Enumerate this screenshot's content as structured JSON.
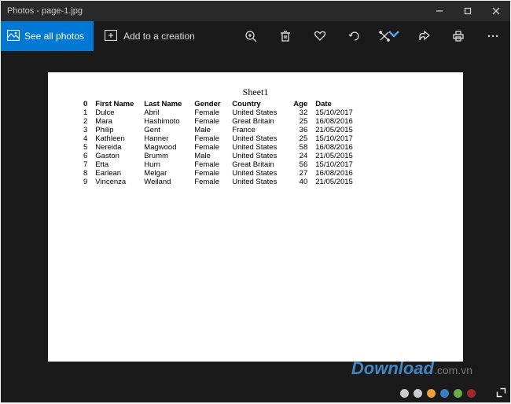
{
  "titlebar": {
    "title": "Photos - page-1.jpg"
  },
  "toolbar": {
    "see_all_label": "See all photos",
    "add_creation_label": "Add to a creation"
  },
  "sheet": {
    "title": "Sheet1",
    "headers": {
      "idx": "0",
      "fname": "First Name",
      "lname": "Last Name",
      "gender": "Gender",
      "country": "Country",
      "age": "Age",
      "date": "Date"
    },
    "rows": [
      {
        "idx": "1",
        "fname": "Dulce",
        "lname": "Abril",
        "gender": "Female",
        "country": "United States",
        "age": "32",
        "date": "15/10/2017"
      },
      {
        "idx": "2",
        "fname": "Mara",
        "lname": "Hashimoto",
        "gender": "Female",
        "country": "Great Britain",
        "age": "25",
        "date": "16/08/2016"
      },
      {
        "idx": "3",
        "fname": "Philip",
        "lname": "Gent",
        "gender": "Male",
        "country": "France",
        "age": "36",
        "date": "21/05/2015"
      },
      {
        "idx": "4",
        "fname": "Kathleen",
        "lname": "Hanner",
        "gender": "Female",
        "country": "United States",
        "age": "25",
        "date": "15/10/2017"
      },
      {
        "idx": "5",
        "fname": "Nereida",
        "lname": "Magwood",
        "gender": "Female",
        "country": "United States",
        "age": "58",
        "date": "16/08/2016"
      },
      {
        "idx": "6",
        "fname": "Gaston",
        "lname": "Brumm",
        "gender": "Male",
        "country": "United States",
        "age": "24",
        "date": "21/05/2015"
      },
      {
        "idx": "7",
        "fname": "Etta",
        "lname": "Hurn",
        "gender": "Female",
        "country": "Great Britain",
        "age": "56",
        "date": "15/10/2017"
      },
      {
        "idx": "8",
        "fname": "Earlean",
        "lname": "Melgar",
        "gender": "Female",
        "country": "United States",
        "age": "27",
        "date": "16/08/2016"
      },
      {
        "idx": "9",
        "fname": "Vincenza",
        "lname": "Weiland",
        "gender": "Female",
        "country": "United States",
        "age": "40",
        "date": "21/05/2015"
      }
    ]
  },
  "watermark": {
    "main": "Download",
    "suffix": ".com.vn"
  },
  "dots": [
    "#ccc",
    "#ccc",
    "#e8a33a",
    "#3a7fc4",
    "#6aac4a",
    "#a02a2a"
  ]
}
